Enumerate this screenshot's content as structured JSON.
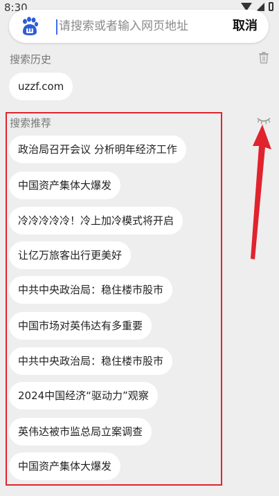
{
  "status_bar": {
    "time": "8:30"
  },
  "search": {
    "placeholder": "请搜索或者输入网页地址",
    "value": "",
    "cancel_label": "取消"
  },
  "history": {
    "title": "搜索历史",
    "items": [
      "uzzf.com"
    ]
  },
  "recommend": {
    "title": "搜索推荐",
    "items": [
      "政治局召开会议 分析明年经济工作",
      "中国资产集体大爆发",
      "冷冷冷冷冷！冷上加冷模式将开启",
      "让亿万旅客出行更美好",
      "中共中央政治局：稳住楼市股市",
      "中国市场对英伟达有多重要",
      "中共中央政治局：稳住楼市股市",
      "2024中国经济“驱动力”观察",
      "英伟达被市监总局立案调查",
      "中国资产集体大爆发"
    ]
  },
  "icons": {
    "logo": "baidu-paw-icon",
    "delete_history": "trash-icon",
    "hide_recommend": "closed-eye-icon"
  },
  "colors": {
    "background": "#eeeeee",
    "annotation_red": "#e0232e",
    "logo_blue": "#2e5bd8",
    "caret_blue": "#3a6df0"
  }
}
